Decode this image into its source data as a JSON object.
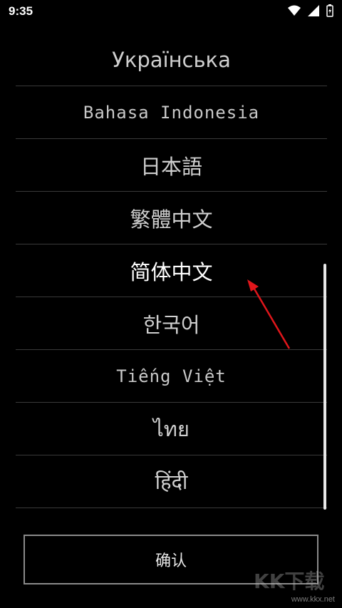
{
  "status_bar": {
    "time": "9:35",
    "icons": [
      "wifi-icon",
      "signal-icon",
      "battery-charging-icon"
    ]
  },
  "languages": [
    {
      "label": "Українська",
      "selected": false
    },
    {
      "label": "Bahasa Indonesia",
      "selected": false
    },
    {
      "label": "日本語",
      "selected": false
    },
    {
      "label": "繁體中文",
      "selected": false
    },
    {
      "label": "简体中文",
      "selected": true
    },
    {
      "label": "한국어",
      "selected": false
    },
    {
      "label": "Tiếng Việt",
      "selected": false
    },
    {
      "label": "ไทย",
      "selected": false
    },
    {
      "label": "हिंदी",
      "selected": false
    }
  ],
  "confirm_label": "确认",
  "watermark": "www.kkx.net",
  "colors": {
    "background": "#000000",
    "text": "#ffffff",
    "divider": "#3a3a3a",
    "annotation_arrow": "#e0161b"
  }
}
